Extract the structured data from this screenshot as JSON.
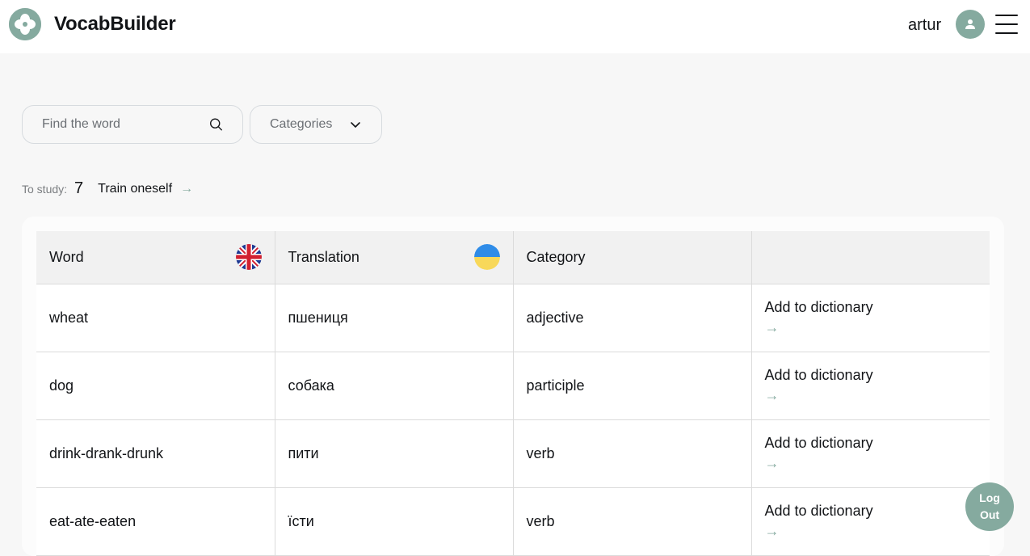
{
  "app": {
    "title": "VocabBuilder"
  },
  "user": {
    "name": "artur"
  },
  "search": {
    "placeholder": "Find the word",
    "value": ""
  },
  "filter": {
    "categories_label": "Categories"
  },
  "study": {
    "label": "To study:",
    "count": "7",
    "train_label": "Train oneself",
    "arrow": "→"
  },
  "table": {
    "headers": {
      "word": "Word",
      "translation": "Translation",
      "category": "Category",
      "action": ""
    },
    "rows": [
      {
        "word": "wheat",
        "translation": "пшениця",
        "category": "adjective",
        "action": "Add to dictionary",
        "arrow": "→"
      },
      {
        "word": "dog",
        "translation": "собака",
        "category": "participle",
        "action": "Add to dictionary",
        "arrow": "→"
      },
      {
        "word": "drink-drank-drunk",
        "translation": "пити",
        "category": "verb",
        "action": "Add to dictionary",
        "arrow": "→"
      },
      {
        "word": "eat-ate-eaten",
        "translation": "їсти",
        "category": "verb",
        "action": "Add to dictionary",
        "arrow": "→"
      }
    ]
  },
  "logout": {
    "line1": "Log",
    "line2": "Out"
  },
  "icons": {
    "logo": "logo-icon",
    "avatar": "user-icon",
    "menu": "burger-menu-icon",
    "search": "search-icon",
    "chevron": "chevron-down-icon",
    "uk_flag": "uk-flag-icon",
    "ua_flag": "ukraine-flag-icon"
  },
  "colors": {
    "accent": "#85aa9f",
    "background": "#f7f7f7",
    "text": "#121417"
  }
}
